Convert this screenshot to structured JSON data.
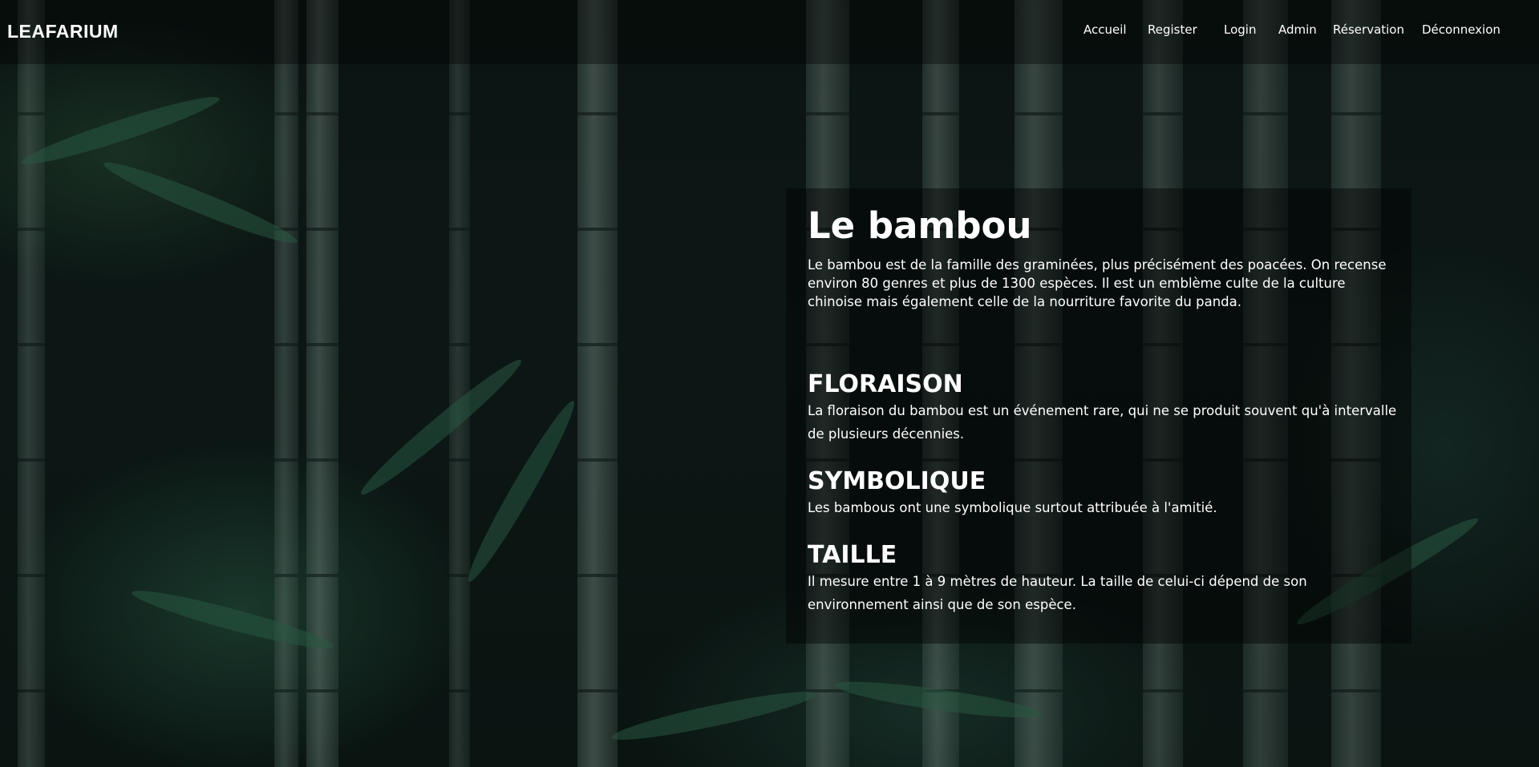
{
  "brand": {
    "logo_text": "LEAFARIUM"
  },
  "nav": {
    "items": [
      {
        "label": "Accueil"
      },
      {
        "label": "Register"
      },
      {
        "label": "Login"
      },
      {
        "label": "Admin"
      },
      {
        "label": "Réservation"
      },
      {
        "label": "Déconnexion"
      }
    ]
  },
  "main": {
    "title": "Le bambou",
    "intro": "Le bambou est de la famille des graminées, plus précisément des poacées. On recense environ 80 genres et plus de 1300 espèces. Il est un emblème culte de la culture chinoise mais également celle de la nourriture favorite du panda.",
    "sections": [
      {
        "title": "FLORAISON",
        "text": "La floraison du bambou est un événement rare, qui ne se produit souvent qu'à intervalle de plusieurs décennies."
      },
      {
        "title": "SYMBOLIQUE",
        "text": "Les bambous ont une symbolique surtout attribuée à l'amitié."
      },
      {
        "title": "TAILLE",
        "text": "Il mesure entre 1 à 9 mètres de hauteur. La taille de celui-ci dépend de son environnement ainsi que de son espèce."
      }
    ]
  },
  "background": {
    "icon": "bamboo-forest-photo",
    "colors": {
      "base": "#0b1412",
      "foliage": "#1c3e30",
      "stalk": "#76887f"
    }
  }
}
